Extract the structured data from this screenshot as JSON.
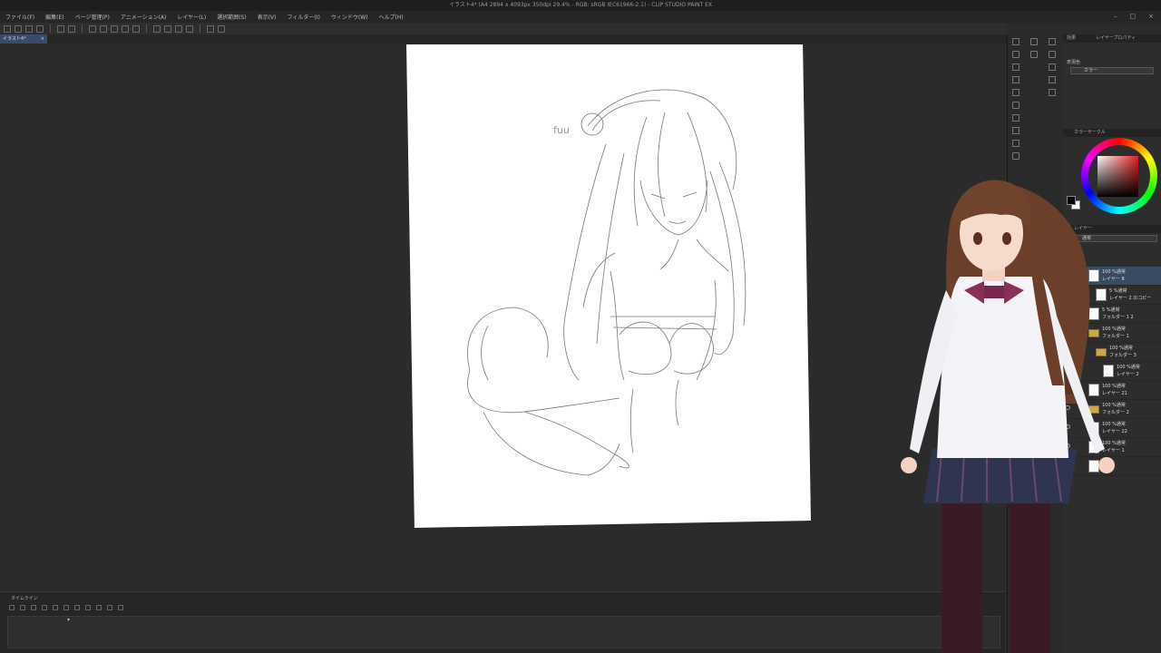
{
  "window": {
    "title": "イラスト4* (A4 2894 x 4093px 350dpi 29.4% - RGB: sRGB IEC61966-2.1) - CLIP STUDIO PAINT EX",
    "controls": [
      "–",
      "□",
      "×"
    ]
  },
  "menu": [
    "ファイル(F)",
    "編集(E)",
    "ページ管理(P)",
    "アニメーション(A)",
    "レイヤー(L)",
    "選択範囲(S)",
    "表示(V)",
    "フィルター(I)",
    "ウィンドウ(W)",
    "ヘルプ(H)"
  ],
  "doc_tab": {
    "label": "イラスト4*",
    "close": "×"
  },
  "canvas": {
    "sketch_text": "fuu"
  },
  "timeline": {
    "header": "タイムライン",
    "frame_marker": "▾"
  },
  "panels": {
    "top_tabs": {
      "left": "効果",
      "right": "レイヤープロパティ"
    },
    "display_color_label": "表現色",
    "display_color_value": "カラー",
    "color_circle_tab": "カラーサークル",
    "layer_tab": "レイヤー",
    "blend_mode": "通常",
    "layers": [
      {
        "opacity": "100 %通常",
        "name": "レイヤー 8",
        "selected": true,
        "kind": "raster",
        "indent": 0
      },
      {
        "opacity": "5 %通常",
        "name": "レイヤー 2 のコピー",
        "selected": false,
        "kind": "raster",
        "indent": 1
      },
      {
        "opacity": "5 %通常",
        "name": "フォルダー 1 2",
        "selected": false,
        "kind": "sketch",
        "indent": 0
      },
      {
        "opacity": "100 %通常",
        "name": "フォルダー 1",
        "selected": false,
        "kind": "folder",
        "indent": 0
      },
      {
        "opacity": "100 %通常",
        "name": "フォルダー 3",
        "selected": false,
        "kind": "folder",
        "indent": 1
      },
      {
        "opacity": "100 %通常",
        "name": "レイヤー 2",
        "selected": false,
        "kind": "raster",
        "indent": 2
      },
      {
        "opacity": "100 %通常",
        "name": "レイヤー 21",
        "selected": false,
        "kind": "raster",
        "indent": 0
      },
      {
        "opacity": "100 %通常",
        "name": "フォルダー 2",
        "selected": false,
        "kind": "folder",
        "indent": 0
      },
      {
        "opacity": "100 %通常",
        "name": "レイヤー 22",
        "selected": false,
        "kind": "raster",
        "indent": 0
      },
      {
        "opacity": "100 %通常",
        "name": "レイヤー 1",
        "selected": false,
        "kind": "raster",
        "indent": 0
      },
      {
        "opacity": "",
        "name": "",
        "selected": false,
        "kind": "paper",
        "indent": 0
      }
    ]
  },
  "colors": {
    "accent_selected": "#3b4a63",
    "main_color": "#000000",
    "sub_color": "#ffffff"
  }
}
